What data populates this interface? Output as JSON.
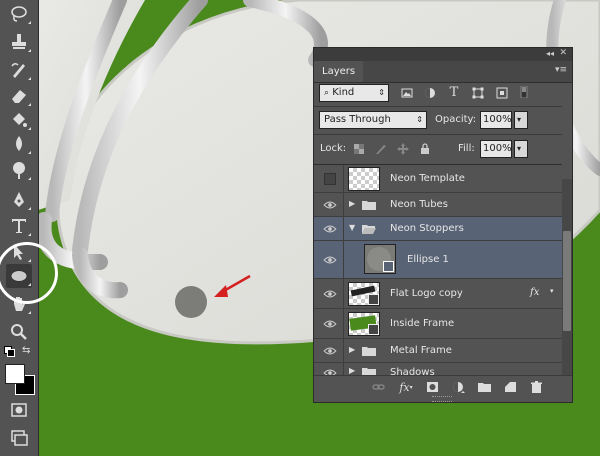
{
  "panel": {
    "tab": "Layers",
    "filter": {
      "kind_label": "Kind"
    },
    "blend_mode": "Pass Through",
    "opacity_label": "Opacity:",
    "opacity_value": "100%",
    "lock_label": "Lock:",
    "fill_label": "Fill:",
    "fill_value": "100%"
  },
  "layers": [
    {
      "name": "Neon Template",
      "type": "layer",
      "visible": false,
      "selected": false
    },
    {
      "name": "Neon Tubes",
      "type": "group",
      "expanded": false,
      "visible": true,
      "selected": false
    },
    {
      "name": "Neon Stoppers",
      "type": "group",
      "expanded": true,
      "visible": true,
      "selected": true
    },
    {
      "name": "Ellipse 1",
      "type": "shape",
      "visible": true,
      "selected": true
    },
    {
      "name": "Flat Logo copy",
      "type": "smart-object",
      "visible": true,
      "selected": false,
      "fx": "fx"
    },
    {
      "name": "Inside Frame",
      "type": "smart-object",
      "visible": true,
      "selected": false
    },
    {
      "name": "Metal Frame",
      "type": "group",
      "expanded": false,
      "visible": true,
      "selected": false
    },
    {
      "name": "Shadows",
      "type": "group",
      "expanded": false,
      "visible": true,
      "selected": false
    }
  ],
  "footer": {
    "fx_label": "fx"
  },
  "colors": {
    "canvas_green": "#4a8a1c",
    "panel_bg": "#535353",
    "selected_row": "#596376",
    "annotation_red": "#d42020"
  },
  "toolbar_tools": [
    "lasso-icon",
    "clone-stamp-icon",
    "history-brush-icon",
    "eraser-icon",
    "paint-bucket-icon",
    "blur-icon",
    "dodge-icon",
    "pen-icon",
    "type-icon",
    "path-select-icon",
    "ellipse-tool-icon",
    "hand-icon",
    "zoom-icon"
  ]
}
